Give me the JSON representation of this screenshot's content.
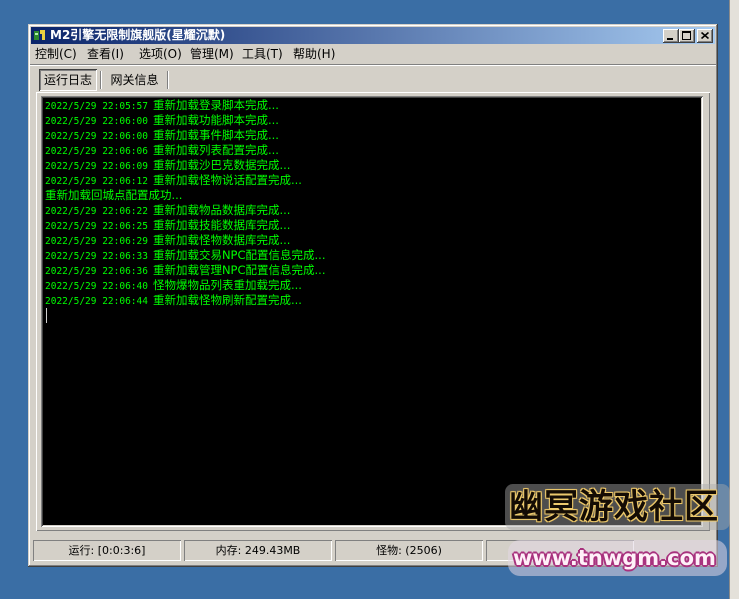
{
  "window": {
    "title": "M2引擎无限制旗舰版(星耀沉默)"
  },
  "menu": {
    "items": [
      {
        "label": "控制(C)"
      },
      {
        "label": "查看(I)"
      },
      {
        "label": "选项(O)"
      },
      {
        "label": "管理(M)"
      },
      {
        "label": "工具(T)"
      },
      {
        "label": "帮助(H)"
      }
    ]
  },
  "tabs": [
    {
      "label": "运行日志",
      "selected": true
    },
    {
      "label": "网关信息",
      "selected": false
    }
  ],
  "log": {
    "lines": [
      {
        "time": "2022/5/29 22:05:57",
        "msg": "重新加载登录脚本完成..."
      },
      {
        "time": "2022/5/29 22:06:00",
        "msg": "重新加载功能脚本完成..."
      },
      {
        "time": "2022/5/29 22:06:00",
        "msg": "重新加载事件脚本完成..."
      },
      {
        "time": "2022/5/29 22:06:06",
        "msg": "重新加载列表配置完成..."
      },
      {
        "time": "2022/5/29 22:06:09",
        "msg": "重新加载沙巴克数据完成..."
      },
      {
        "time": "2022/5/29 22:06:12",
        "msg": "重新加载怪物说话配置完成..."
      },
      {
        "msg": "重新加载回城点配置成功..."
      },
      {
        "time": "2022/5/29 22:06:22",
        "msg": "重新加载物品数据库完成..."
      },
      {
        "time": "2022/5/29 22:06:25",
        "msg": "重新加载技能数据库完成..."
      },
      {
        "time": "2022/5/29 22:06:29",
        "msg": "重新加载怪物数据库完成..."
      },
      {
        "time": "2022/5/29 22:06:33",
        "msg": "重新加载交易NPC配置信息完成..."
      },
      {
        "time": "2022/5/29 22:06:36",
        "msg": "重新加载管理NPC配置信息完成..."
      },
      {
        "time": "2022/5/29 22:06:40",
        "msg": "怪物爆物品列表重加载完成..."
      },
      {
        "time": "2022/5/29 22:06:44",
        "msg": "重新加载怪物刷新配置完成..."
      }
    ]
  },
  "status": {
    "panels": [
      {
        "text": "运行: [0:0:3:6]"
      },
      {
        "text": "内存: 249.43MB"
      },
      {
        "text": "怪物: (2506)"
      }
    ]
  },
  "watermark": {
    "name": "幽冥游戏社区",
    "url": "www.tnwgm.com"
  },
  "icons": {
    "app": "app-icon",
    "minimize": "minimize-icon",
    "maximize": "maximize-icon",
    "close": "close-icon"
  },
  "colors": {
    "desktop": "#3a6ea5",
    "window_face": "#d4d0c8",
    "title_start": "#0a246a",
    "title_end": "#a6caf0",
    "log_background": "#000000",
    "log_text": "#00ff00",
    "watermark_outline": "#a8327e"
  }
}
